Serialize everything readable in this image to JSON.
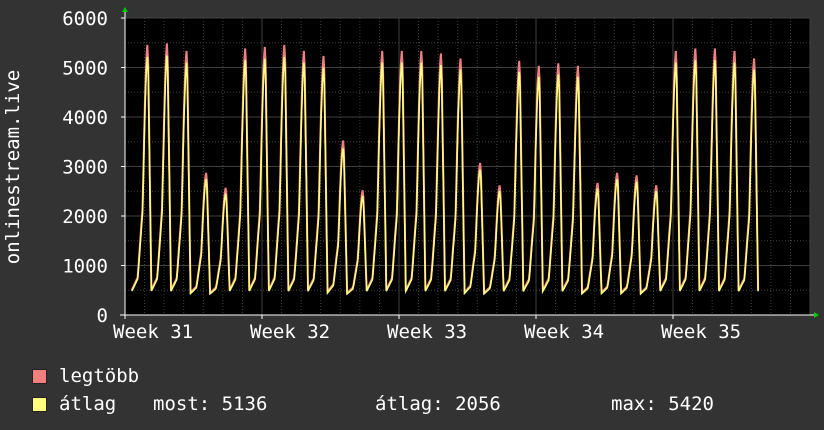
{
  "chart_data": {
    "type": "line",
    "ylabel": "onlinestream.live",
    "ylim": [
      0,
      6000
    ],
    "yticks": [
      0,
      1000,
      2000,
      3000,
      4000,
      5000,
      6000
    ],
    "xlim": [
      0,
      35
    ],
    "xticks": [
      {
        "label": "Week 31",
        "day": 0
      },
      {
        "label": "Week 32",
        "day": 7
      },
      {
        "label": "Week 33",
        "day": 14
      },
      {
        "label": "Week 34",
        "day": 21
      },
      {
        "label": "Week 35",
        "day": 28
      }
    ],
    "daily_peaks": [
      5420,
      5450,
      5300,
      2850,
      2550,
      5350,
      5380,
      5420,
      5300,
      5200,
      3500,
      2500,
      5300,
      5300,
      5300,
      5250,
      5150,
      3050,
      2600,
      5100,
      5000,
      5050,
      5000,
      2650,
      2850,
      2800,
      2600,
      5300,
      5350,
      5350,
      5300,
      5150
    ],
    "daily_min": 400,
    "series": [
      {
        "name": "legtöbb",
        "color": "#f08080"
      },
      {
        "name": "átlag",
        "color": "#ffff80"
      }
    ],
    "grid": true,
    "legend_position": "bottom"
  },
  "legend": {
    "items": [
      {
        "label": "legtöbb",
        "color": "#f08080"
      },
      {
        "label": "átlag",
        "color": "#ffff80"
      }
    ],
    "stats": {
      "now": "most: 5136",
      "avg": "átlag: 2056",
      "max": "max: 5420"
    }
  },
  "colors": {
    "background": "#333333",
    "plot_background": "#000000",
    "grid": "#404040",
    "axis": "#ffffff",
    "arrow": "#00cc00"
  }
}
